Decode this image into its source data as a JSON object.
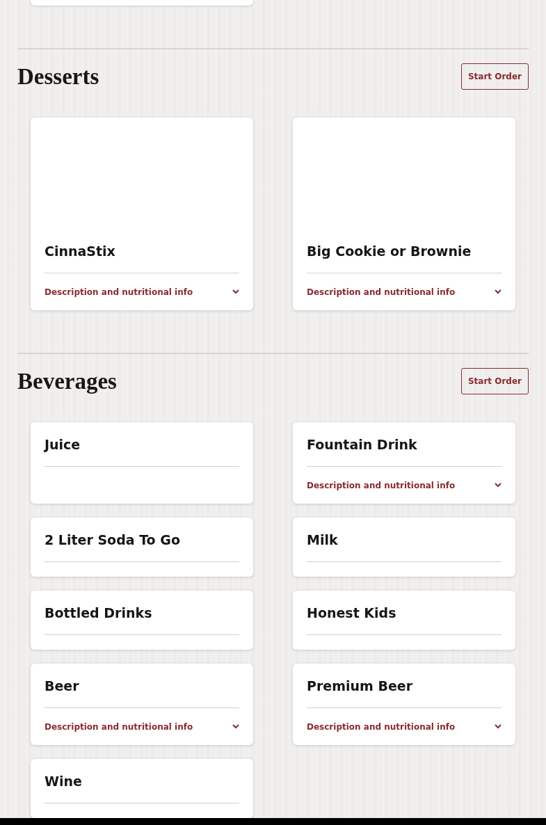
{
  "sections": [
    {
      "title": "Desserts",
      "button": "Start Order",
      "items": [
        {
          "name": "CinnaStix",
          "kind": "image",
          "info": "Description and nutritional info",
          "expanded": false
        },
        {
          "name": "Big Cookie or Brownie",
          "kind": "image",
          "info": "Description and nutritional info",
          "expanded": false
        }
      ]
    },
    {
      "title": "Beverages",
      "button": "Start Order",
      "items": [
        {
          "name": "Juice",
          "kind": "plain"
        },
        {
          "name": "Fountain Drink",
          "kind": "plain",
          "info": "Description and nutritional info",
          "expanded": false
        },
        {
          "name": "2 Liter Soda To Go",
          "kind": "plain"
        },
        {
          "name": "Milk",
          "kind": "plain"
        },
        {
          "name": "Bottled Drinks",
          "kind": "plain"
        },
        {
          "name": "Honest Kids",
          "kind": "plain"
        },
        {
          "name": "Beer",
          "kind": "plain",
          "info": "Description and nutritional info",
          "expanded": false
        },
        {
          "name": "Premium Beer",
          "kind": "plain",
          "info": "Description and nutritional info",
          "expanded": false
        },
        {
          "name": "Wine",
          "kind": "plain"
        }
      ]
    }
  ]
}
